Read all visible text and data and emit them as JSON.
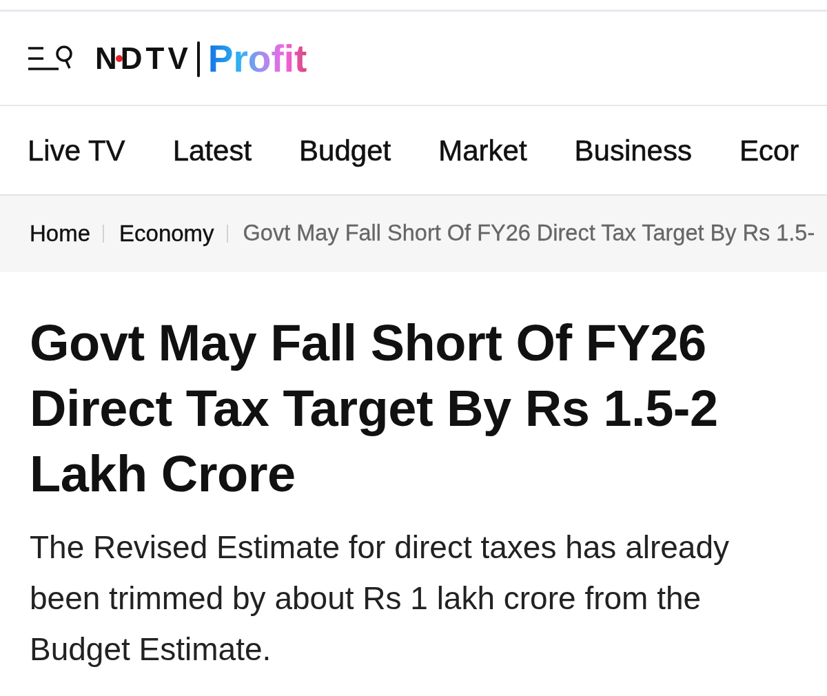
{
  "header": {
    "logo": {
      "brand": "NDTV",
      "product": "Profit"
    }
  },
  "nav": {
    "items": [
      {
        "label": "Live TV"
      },
      {
        "label": "Latest"
      },
      {
        "label": "Budget"
      },
      {
        "label": "Market"
      },
      {
        "label": "Business"
      },
      {
        "label": "Ecor"
      }
    ]
  },
  "breadcrumb": {
    "items": [
      {
        "label": "Home",
        "kind": "link"
      },
      {
        "label": "Economy",
        "kind": "link"
      },
      {
        "label": "Govt May Fall Short Of FY26 Direct Tax Target By Rs 1.5-",
        "kind": "current"
      }
    ]
  },
  "article": {
    "headline": "Govt May Fall Short Of FY26 Direct Tax Target By Rs 1.5-2 Lakh Crore",
    "summary": "The Revised Estimate for direct taxes has already been trimmed by about Rs 1 lakh crore from the Budget Estimate."
  }
}
